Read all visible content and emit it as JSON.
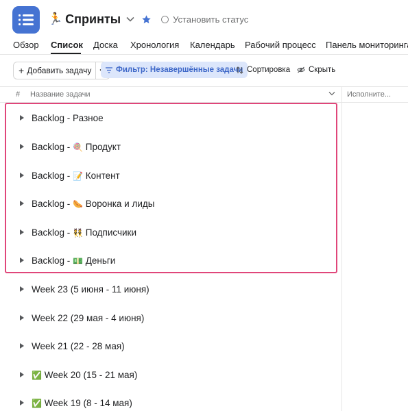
{
  "header": {
    "app_icon": "list-icon",
    "emoji": "🏃",
    "title": "Спринты",
    "status_label": "Установить статус",
    "accent_color": "#4573d2"
  },
  "tabs": [
    "Обзор",
    "Список",
    "Доска",
    "Хронология",
    "Календарь",
    "Рабочий процесс",
    "Панель мониторинга"
  ],
  "active_tab": "Список",
  "toolbar": {
    "add_task": "Добавить задачу",
    "filter": "Фильтр: Незавершённые задачи",
    "sort": "Сортировка",
    "hide": "Скрыть"
  },
  "table": {
    "col_number": "#",
    "col_name": "Название задачи",
    "col_assignee": "Исполните..."
  },
  "sections": [
    {
      "prefix": "Backlog - Разное",
      "emoji": "",
      "name": ""
    },
    {
      "prefix": "Backlog - ",
      "emoji": "🍭",
      "name": " Продукт"
    },
    {
      "prefix": "Backlog - ",
      "emoji": "📝",
      "name": " Контент"
    },
    {
      "prefix": "Backlog - ",
      "emoji": "🌭",
      "name": " Воронка и лиды"
    },
    {
      "prefix": "Backlog - ",
      "emoji": "👯",
      "name": " Подписчики"
    },
    {
      "prefix": "Backlog - ",
      "emoji": "💵",
      "name": " Деньги"
    },
    {
      "prefix": "",
      "emoji": "",
      "name": "Week 23 (5 июня - 11 июня)"
    },
    {
      "prefix": "",
      "emoji": "",
      "name": "Week 22 (29 мая - 4 июня)"
    },
    {
      "prefix": "",
      "emoji": "",
      "name": "Week 21 (22 - 28 мая)"
    },
    {
      "prefix": "",
      "emoji": "✅",
      "name": " Week 20 (15 - 21 мая)"
    },
    {
      "prefix": "",
      "emoji": "✅",
      "name": " Week 19 (8 - 14 мая)"
    }
  ],
  "highlight_color": "#e0467a"
}
